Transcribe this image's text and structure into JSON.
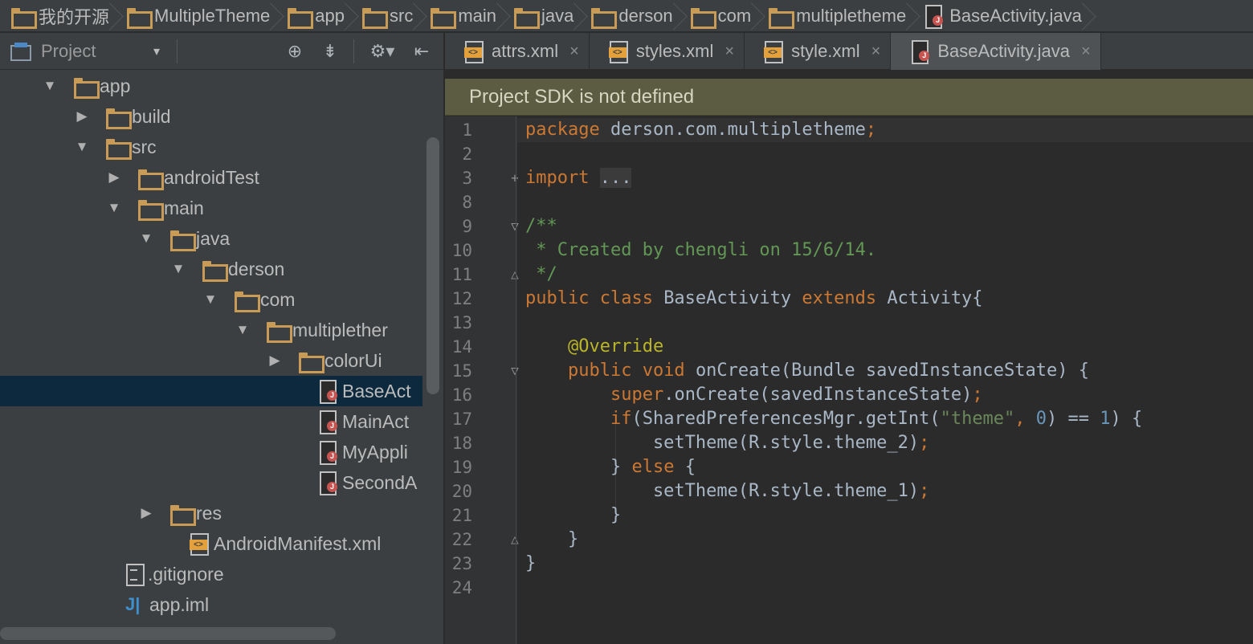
{
  "breadcrumb": [
    "我的开源",
    "MultipleTheme",
    "app",
    "src",
    "main",
    "java",
    "derson",
    "com",
    "multipletheme",
    "BaseActivity.java"
  ],
  "project_panel": {
    "title": "Project",
    "dropdown": "▾",
    "toolbar_icons": [
      "target-icon",
      "collapse-icon",
      "gear-icon",
      "hide-icon"
    ]
  },
  "tree": [
    {
      "label": "app",
      "icon": "folder",
      "arrow": "▼",
      "depth": 1
    },
    {
      "label": "build",
      "icon": "folder",
      "arrow": "▶",
      "depth": 2
    },
    {
      "label": "src",
      "icon": "folder",
      "arrow": "▼",
      "depth": 2
    },
    {
      "label": "androidTest",
      "icon": "folder",
      "arrow": "▶",
      "depth": 3
    },
    {
      "label": "main",
      "icon": "folder",
      "arrow": "▼",
      "depth": 3
    },
    {
      "label": "java",
      "icon": "folder",
      "arrow": "▼",
      "depth": 4
    },
    {
      "label": "derson",
      "icon": "folder",
      "arrow": "▼",
      "depth": 5
    },
    {
      "label": "com",
      "icon": "folder",
      "arrow": "▼",
      "depth": 6
    },
    {
      "label": "multiplether",
      "icon": "folder",
      "arrow": "▼",
      "depth": 7
    },
    {
      "label": "colorUi",
      "icon": "folder",
      "arrow": "▶",
      "depth": 8
    },
    {
      "label": "BaseAct",
      "icon": "java",
      "arrow": "",
      "depth": 9,
      "selected": true
    },
    {
      "label": "MainAct",
      "icon": "java",
      "arrow": "",
      "depth": 9
    },
    {
      "label": "MyAppli",
      "icon": "java",
      "arrow": "",
      "depth": 9
    },
    {
      "label": "SecondA",
      "icon": "java",
      "arrow": "",
      "depth": 9
    },
    {
      "label": "res",
      "icon": "folder",
      "arrow": "▶",
      "depth": 4
    },
    {
      "label": "AndroidManifest.xml",
      "icon": "xml",
      "arrow": "",
      "depth": 5
    },
    {
      "label": ".gitignore",
      "icon": "text",
      "arrow": "",
      "depth": 3
    },
    {
      "label": "app.iml",
      "icon": "iml",
      "arrow": "",
      "depth": 3
    }
  ],
  "tabs": [
    {
      "label": "attrs.xml",
      "icon": "xml",
      "close": "×"
    },
    {
      "label": "styles.xml",
      "icon": "xml",
      "close": "×"
    },
    {
      "label": "style.xml",
      "icon": "xml",
      "close": "×"
    },
    {
      "label": "BaseActivity.java",
      "icon": "java",
      "close": "×",
      "active": true
    }
  ],
  "banner": "Project SDK is not defined",
  "code_lines": [
    {
      "n": "1",
      "tokens": [
        [
          "kw",
          "package "
        ],
        [
          "",
          "derson.com.multipletheme"
        ],
        [
          "kw",
          ";"
        ]
      ]
    },
    {
      "n": "2",
      "tokens": []
    },
    {
      "n": "3",
      "tokens": [
        [
          "kw",
          "import "
        ],
        [
          "fold",
          "..."
        ]
      ],
      "fold": "+"
    },
    {
      "n": "8",
      "tokens": []
    },
    {
      "n": "9",
      "tokens": [
        [
          "cm",
          "/**"
        ]
      ],
      "fold": "▽"
    },
    {
      "n": "10",
      "tokens": [
        [
          "cm",
          " * Created by chengli on 15/6/14."
        ]
      ]
    },
    {
      "n": "11",
      "tokens": [
        [
          "cm",
          " */"
        ]
      ],
      "fold": "△"
    },
    {
      "n": "12",
      "tokens": [
        [
          "kw",
          "public class "
        ],
        [
          "",
          "BaseActivity "
        ],
        [
          "kw",
          "extends "
        ],
        [
          "",
          "Activity{"
        ]
      ]
    },
    {
      "n": "13",
      "tokens": []
    },
    {
      "n": "14",
      "tokens": [
        [
          "",
          "    "
        ],
        [
          "ann",
          "@Override"
        ]
      ]
    },
    {
      "n": "15",
      "tokens": [
        [
          "",
          "    "
        ],
        [
          "kw",
          "public void "
        ],
        [
          "",
          "onCreate(Bundle savedInstanceState) {"
        ]
      ],
      "fold": "▽"
    },
    {
      "n": "16",
      "tokens": [
        [
          "",
          "        "
        ],
        [
          "kw",
          "super"
        ],
        [
          "",
          ".onCreate(savedInstanceState)"
        ],
        [
          "kw",
          ";"
        ]
      ]
    },
    {
      "n": "17",
      "tokens": [
        [
          "",
          "        "
        ],
        [
          "kw",
          "if"
        ],
        [
          "",
          "(SharedPreferencesMgr.getInt("
        ],
        [
          "str",
          "\"theme\""
        ],
        [
          "kw",
          ", "
        ],
        [
          "num",
          "0"
        ],
        [
          "",
          ") == "
        ],
        [
          "num",
          "1"
        ],
        [
          "",
          ") {"
        ]
      ]
    },
    {
      "n": "18",
      "tokens": [
        [
          "",
          "            setTheme(R.style.theme_2)"
        ],
        [
          "kw",
          ";"
        ]
      ]
    },
    {
      "n": "19",
      "tokens": [
        [
          "",
          "        } "
        ],
        [
          "kw",
          "else "
        ],
        [
          "",
          "{"
        ]
      ]
    },
    {
      "n": "20",
      "tokens": [
        [
          "",
          "            setTheme(R.style.theme_1)"
        ],
        [
          "kw",
          ";"
        ]
      ]
    },
    {
      "n": "21",
      "tokens": [
        [
          "",
          "        }"
        ]
      ]
    },
    {
      "n": "22",
      "tokens": [
        [
          "",
          "    }"
        ]
      ],
      "fold": "△"
    },
    {
      "n": "23",
      "tokens": [
        [
          "",
          "}"
        ]
      ]
    },
    {
      "n": "24",
      "tokens": []
    }
  ],
  "colors": {
    "bg": "#2b2b2b",
    "panel": "#3c3f41",
    "keyword": "#cc7832",
    "comment": "#629755",
    "string": "#6a8759",
    "number": "#6897bb",
    "annotation": "#bbb529",
    "selection": "#0d293e",
    "banner": "#5c5c42"
  }
}
